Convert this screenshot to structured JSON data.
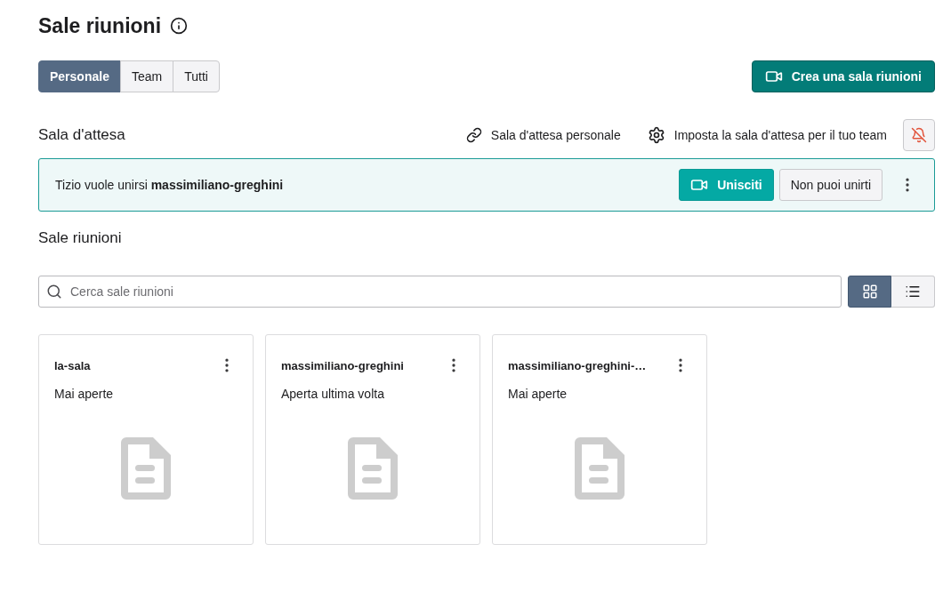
{
  "page": {
    "title": "Sale riunioni"
  },
  "tabs": [
    {
      "label": "Personale",
      "selected": true
    },
    {
      "label": "Team",
      "selected": false
    },
    {
      "label": "Tutti",
      "selected": false
    }
  ],
  "create_button": {
    "label": "Crea una sala riunioni"
  },
  "waiting_room": {
    "title": "Sala d'attesa",
    "personal_link": "Sala d'attesa personale",
    "team_setting": "Imposta la sala d'attesa per il tuo team",
    "notifications_muted": true
  },
  "request": {
    "message": "Tizio vuole unirsi **massimiliano-greghini**",
    "join": "Unisciti",
    "decline": "Non puoi unirti"
  },
  "rooms_section": {
    "title": "Sale riunioni",
    "search_placeholder": "Cerca sale riunioni"
  },
  "views": [
    {
      "kind": "grid",
      "selected": true
    },
    {
      "kind": "list",
      "selected": false
    }
  ],
  "rooms": [
    {
      "name": "la-sala",
      "status": "Mai aperte"
    },
    {
      "name": "massimiliano-greghini",
      "status": "Aperta ultima volta"
    },
    {
      "name": "massimiliano-greghini-…",
      "status": "Mai aperte"
    }
  ]
}
